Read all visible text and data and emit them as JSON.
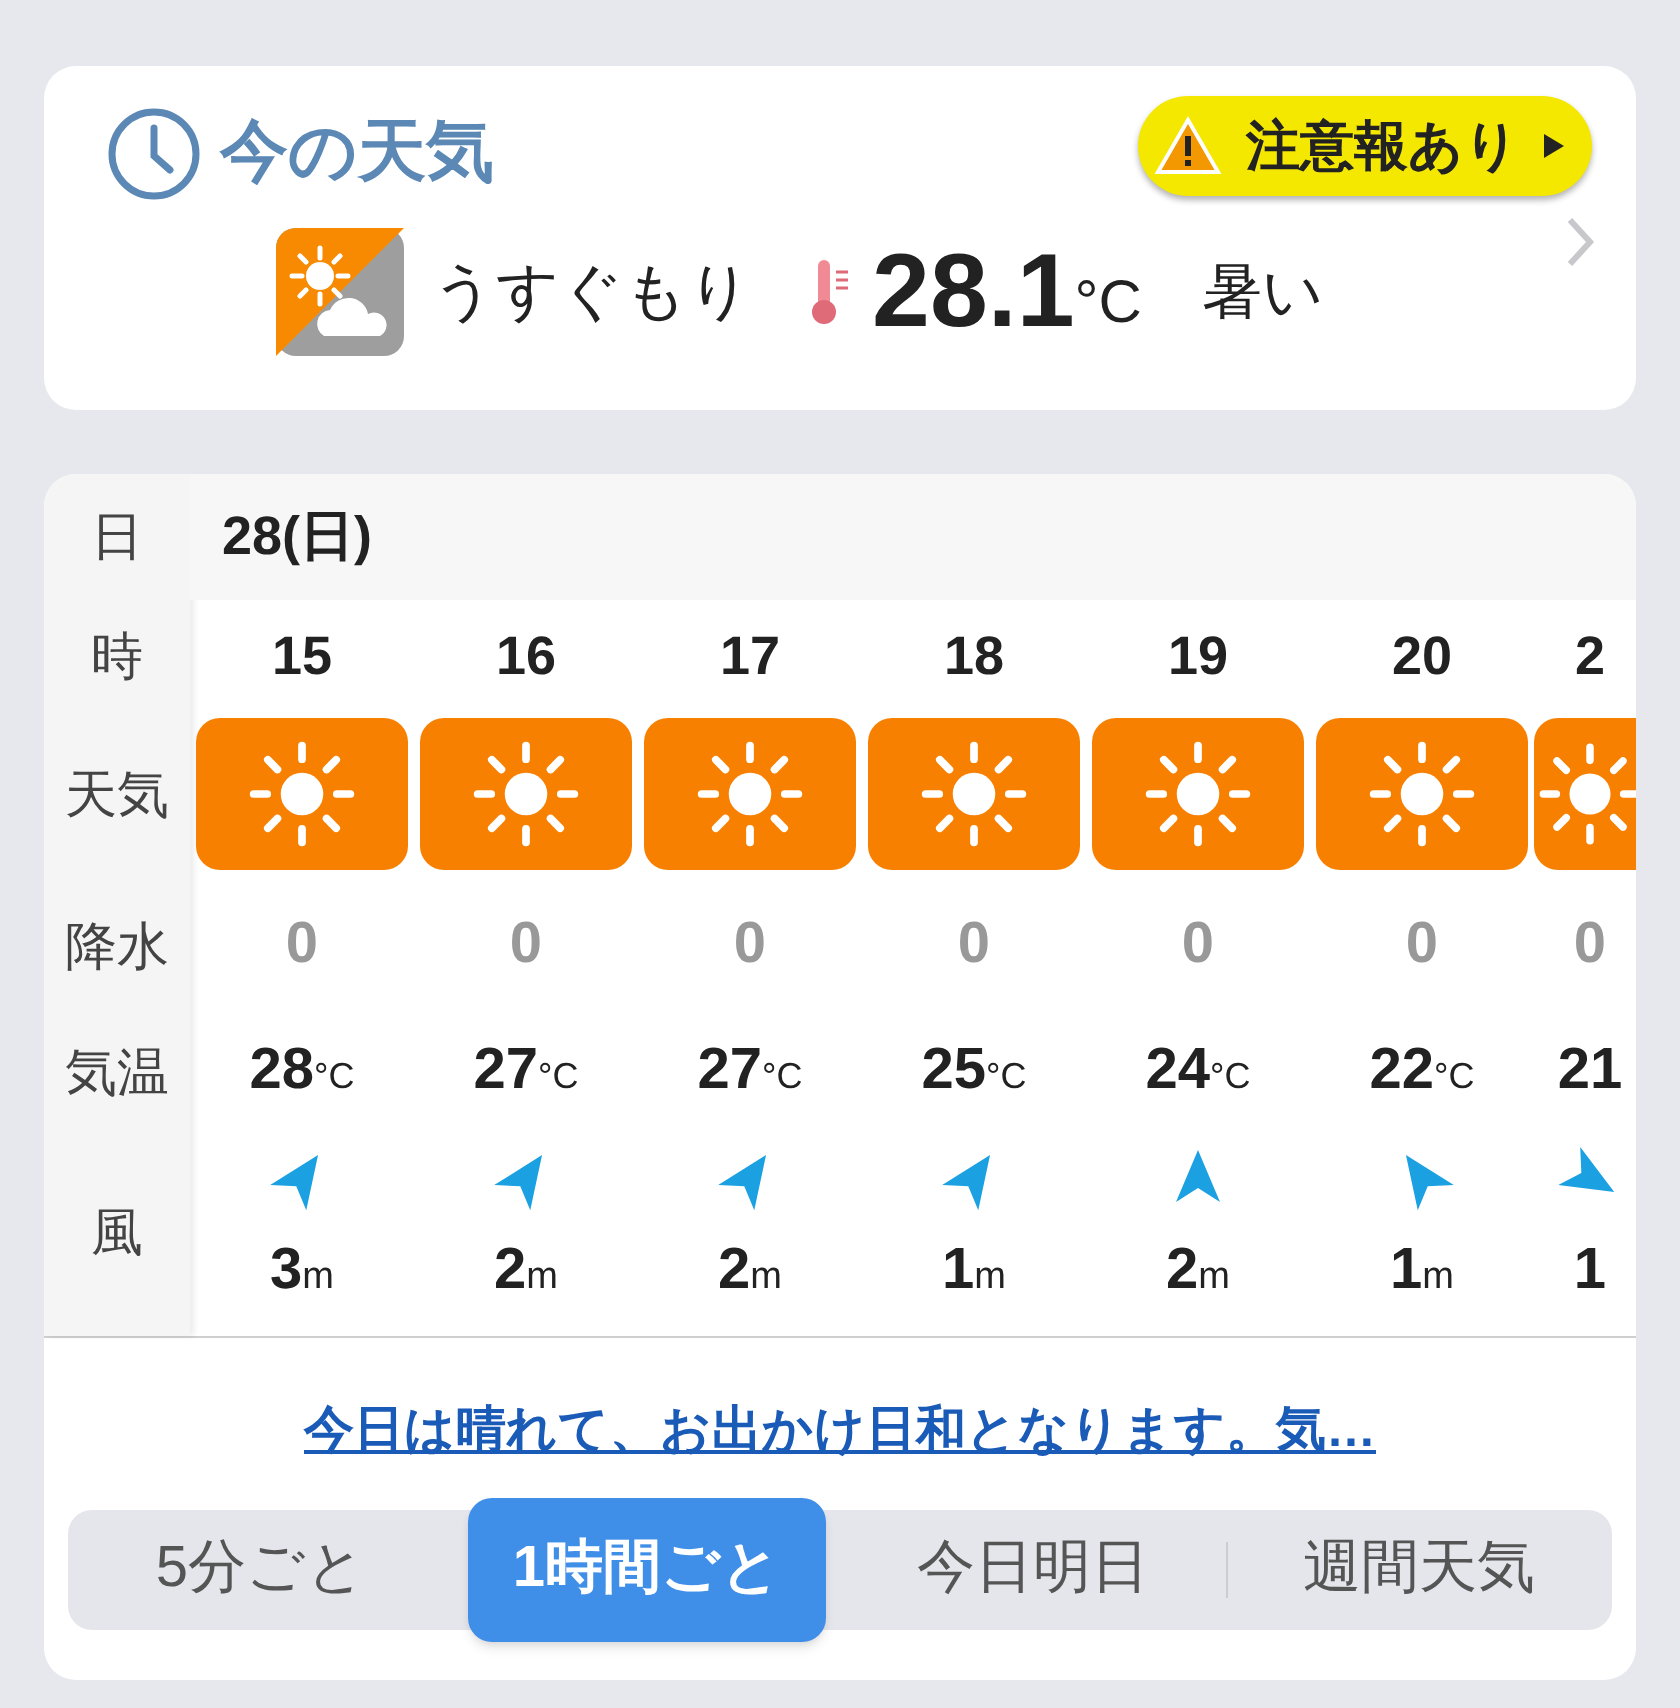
{
  "now": {
    "title": "今の天気",
    "alert": "注意報あり",
    "condition": "うすぐもり",
    "temperature": "28.1",
    "unit": "°C",
    "feeling": "暑い"
  },
  "forecast": {
    "row_labels": [
      "日",
      "時",
      "天気",
      "降水",
      "気温",
      "風"
    ],
    "date": "28(日)",
    "hours": [
      {
        "hour": "15",
        "precip": "0",
        "temp": "28",
        "temp_unit": "°C",
        "kind": "NE",
        "wind": "3",
        "wind_unit": "m"
      },
      {
        "hour": "16",
        "precip": "0",
        "temp": "27",
        "temp_unit": "°C",
        "kind": "NE",
        "wind": "2",
        "wind_unit": "m"
      },
      {
        "hour": "17",
        "precip": "0",
        "temp": "27",
        "temp_unit": "°C",
        "kind": "NE",
        "wind": "2",
        "wind_unit": "m"
      },
      {
        "hour": "18",
        "precip": "0",
        "temp": "25",
        "temp_unit": "°C",
        "kind": "NE",
        "wind": "1",
        "wind_unit": "m"
      },
      {
        "hour": "19",
        "precip": "0",
        "temp": "24",
        "temp_unit": "°C",
        "kind": "N",
        "wind": "2",
        "wind_unit": "m"
      },
      {
        "hour": "20",
        "precip": "0",
        "temp": "22",
        "temp_unit": "°C",
        "kind": "NW",
        "wind": "1",
        "wind_unit": "m"
      },
      {
        "hour": "2",
        "precip": "0",
        "temp": "21",
        "kind": "SE",
        "wind": "1"
      }
    ]
  },
  "summary": "今日は晴れて、お出かけ日和となります。気…",
  "tabs": [
    {
      "label": "5分ごと",
      "selected": false
    },
    {
      "label": "1時間ごと",
      "selected": true
    },
    {
      "label": "今日明日",
      "selected": false
    },
    {
      "label": "週間天気",
      "selected": false
    }
  ]
}
